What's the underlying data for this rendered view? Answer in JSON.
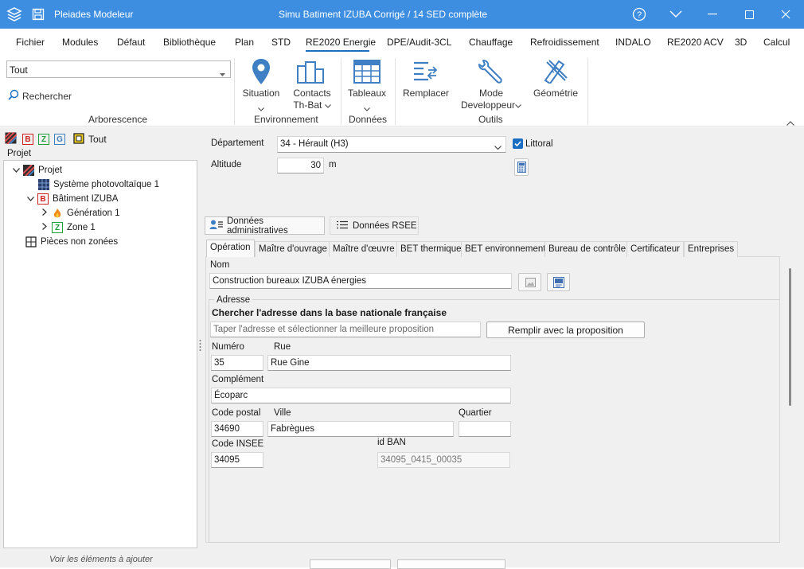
{
  "app": {
    "name": "Pleiades Modeleur",
    "document_title": "Simu Batiment IZUBA Corrigé / 14 SED complète"
  },
  "menu": {
    "items": [
      "Fichier",
      "Modules",
      "Défaut",
      "Bibliothèque",
      "Plan",
      "STD",
      "RE2020 Energie",
      "DPE/Audit-3CL",
      "Chauffage",
      "Refroidissement",
      "INDALO",
      "RE2020 ACV",
      "3D",
      "Calcul"
    ],
    "active": "RE2020 Energie"
  },
  "ribbon": {
    "filter_value": "Tout",
    "search_label": "Rechercher",
    "groups": {
      "arborescence": "Arborescence",
      "environnement": "Environnement",
      "donnees": "Données",
      "outils": "Outils"
    },
    "buttons": {
      "situation": "Situation",
      "contacts_1": "Contacts",
      "contacts_2": "Th-Bat",
      "tableaux": "Tableaux",
      "remplacer": "Remplacer",
      "mode_1": "Mode",
      "mode_2": "Developpeur",
      "geometrie": "Géométrie"
    }
  },
  "left_panel": {
    "filter_buttons": [
      "B",
      "Z",
      "G"
    ],
    "filter_all": "Tout",
    "tree_header": "Projet",
    "tree": [
      {
        "label": "Projet"
      },
      {
        "label": "Système photovoltaïque 1"
      },
      {
        "label": "Bâtiment IZUBA"
      },
      {
        "label": "Génération 1"
      },
      {
        "label": "Zone 1"
      },
      {
        "label": "Pièces non zonées"
      }
    ],
    "footer": "Voir les éléments à ajouter"
  },
  "form": {
    "departement_label": "Département",
    "departement_value": "34 - Hérault (H3)",
    "littoral_label": "Littoral",
    "littoral_checked": true,
    "altitude_label": "Altitude",
    "altitude_value": "30",
    "altitude_unit": "m",
    "main_tabs": [
      "Données administratives",
      "Données RSEE"
    ],
    "sub_tabs": [
      "Opération",
      "Maître d'ouvrage",
      "Maître d'œuvre",
      "BET thermique",
      "BET environnement",
      "Bureau de contrôle",
      "Certificateur",
      "Entreprises"
    ],
    "nom_label": "Nom",
    "nom_value": "Construction bureaux IZUBA énergies",
    "adresse_group": "Adresse",
    "search_heading": "Chercher l'adresse dans la base nationale française",
    "search_placeholder": "Taper l'adresse et sélectionner la meilleure proposition",
    "fill_button": "Remplir avec la proposition",
    "numero_label": "Numéro",
    "numero_value": "35",
    "rue_label": "Rue",
    "rue_value": "Rue Gine",
    "complement_label": "Complément",
    "complement_value": "Écoparc",
    "cp_label": "Code postal",
    "cp_value": "34690",
    "ville_label": "Ville",
    "ville_value": "Fabrègues",
    "quartier_label": "Quartier",
    "quartier_value": "",
    "insee_label": "Code INSEE",
    "insee_value": "34095",
    "idban_label": "id BAN",
    "idban_value": "34095_0415_00035"
  },
  "colors": {
    "titlebar": "#3d8ee0",
    "accent": "#1b6ec2",
    "icon_blue": "#3f7fc4",
    "panel_bg": "#f0f0f0"
  }
}
